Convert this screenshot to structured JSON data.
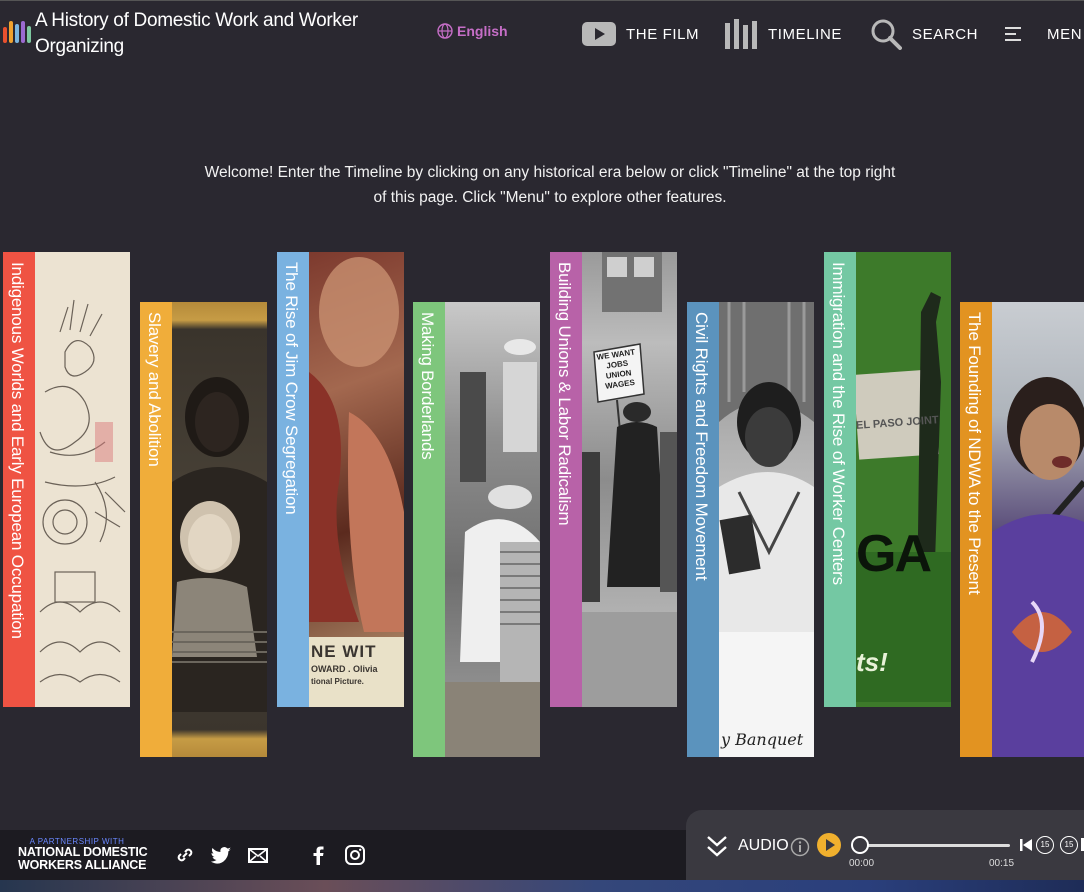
{
  "header": {
    "title": "A History of Domestic Work and Worker Organizing",
    "language": "English",
    "nav": {
      "film": "THE FILM",
      "timeline": "TIMELINE",
      "search": "SEARCH",
      "menu": "MEN"
    },
    "logo_colors": [
      "#e8502f",
      "#f0a22e",
      "#7ab6e0",
      "#9b6ad0",
      "#7ec8a0"
    ]
  },
  "welcome": "Welcome! Enter the Timeline by clicking on any historical era below or click \"Timeline\" at the top right of this page. Click \"Menu\" to explore other features.",
  "eras": [
    {
      "label": "Indigenous Worlds and Early European Occupation",
      "color": "#ef5343",
      "icon": "codex-drawing-image"
    },
    {
      "label": "Slavery and Abolition",
      "color": "#f0ad3a",
      "icon": "portrait-photo-image"
    },
    {
      "label": "The Rise of Jim Crow Segregation",
      "color": "#7ab2e0",
      "icon": "film-poster-image"
    },
    {
      "label": "Making Borderlands",
      "color": "#7ec67c",
      "icon": "workers-photo-image"
    },
    {
      "label": "Building Unions & Labor Radicalism",
      "color": "#b862a8",
      "icon": "protest-photo-image"
    },
    {
      "label": "Civil Rights and Freedom Movement",
      "color": "#5b93bd",
      "icon": "portrait-photo-image"
    },
    {
      "label": "Immigration and the Rise of Worker Centers",
      "color": "#74c8a3",
      "icon": "rally-poster-image"
    },
    {
      "label": "The Founding of NDWA to the Present",
      "color": "#e29321",
      "icon": "speaker-photo-image"
    }
  ],
  "poster_text": {
    "jimcrow_line1": "NE WIT",
    "jimcrow_line2": "OWARD . Olivia",
    "jimcrow_line3": "tional Picture.",
    "union_sign": "WE WANT JOBS UNION WAGES",
    "centers_big": "GA",
    "centers_small": "ts!",
    "centers_banner": "EL PASO JOINT",
    "civil_signature": "y Banquet"
  },
  "footer": {
    "partner_small": "A PARTNERSHIP WITH",
    "partner_name_1": "NATIONAL DOMESTIC",
    "partner_name_2": "WORKERS ALLIANCE"
  },
  "audio": {
    "label": "AUDIO",
    "current_time": "00:00",
    "end_time": "00:15",
    "progress": 0,
    "skip_back": "15",
    "skip_forward": "15"
  }
}
